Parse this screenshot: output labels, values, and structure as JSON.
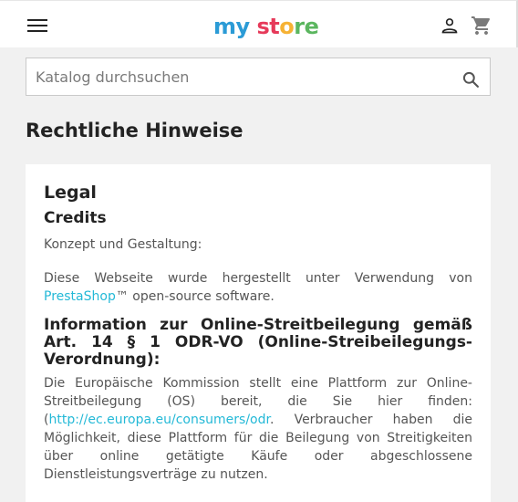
{
  "header": {
    "logo_parts": [
      "my",
      " ",
      "st",
      "o",
      "re"
    ],
    "menu_icon": "hamburger-menu-icon",
    "user_icon": "user-icon",
    "cart_icon": "shopping-cart-icon"
  },
  "search": {
    "placeholder": "Katalog durchsuchen",
    "value": ""
  },
  "page": {
    "title": "Rechtliche Hinweise"
  },
  "content": {
    "heading_legal": "Legal",
    "heading_credits": "Credits",
    "concept_text": "Konzept und Gestaltung:",
    "built_text_before": "Diese Webseite wurde hergestellt unter Verwendung von ",
    "built_link": "PrestaShop",
    "built_text_after": "™ open-source software.",
    "heading_odr": "Information zur Online-Streitbeilegung gemäß Art. 14 § 1 ODR-VO (Online-Streibeilegungs-Verordnung):",
    "odr_text_before": "Die Europäische Kommission stellt eine Plattform zur Online-Streitbeilegung (OS) bereit, die Sie hier finden: (",
    "odr_link": "http://ec.europa.eu/consumers/odr",
    "odr_text_after": ". Verbraucher haben die Möglichkeit, diese Plattform für die Beilegung von Streitigkeiten über online getätigte Käufe oder abgeschlossene Dienstleistungsverträge zu nutzen."
  },
  "colors": {
    "link": "#24b9d7",
    "logo_blue": "#2b9bd6",
    "logo_pink": "#e63a5a",
    "logo_orange": "#f6b234",
    "logo_green": "#5bb65f",
    "logo_purple": "#7c3ea6"
  }
}
